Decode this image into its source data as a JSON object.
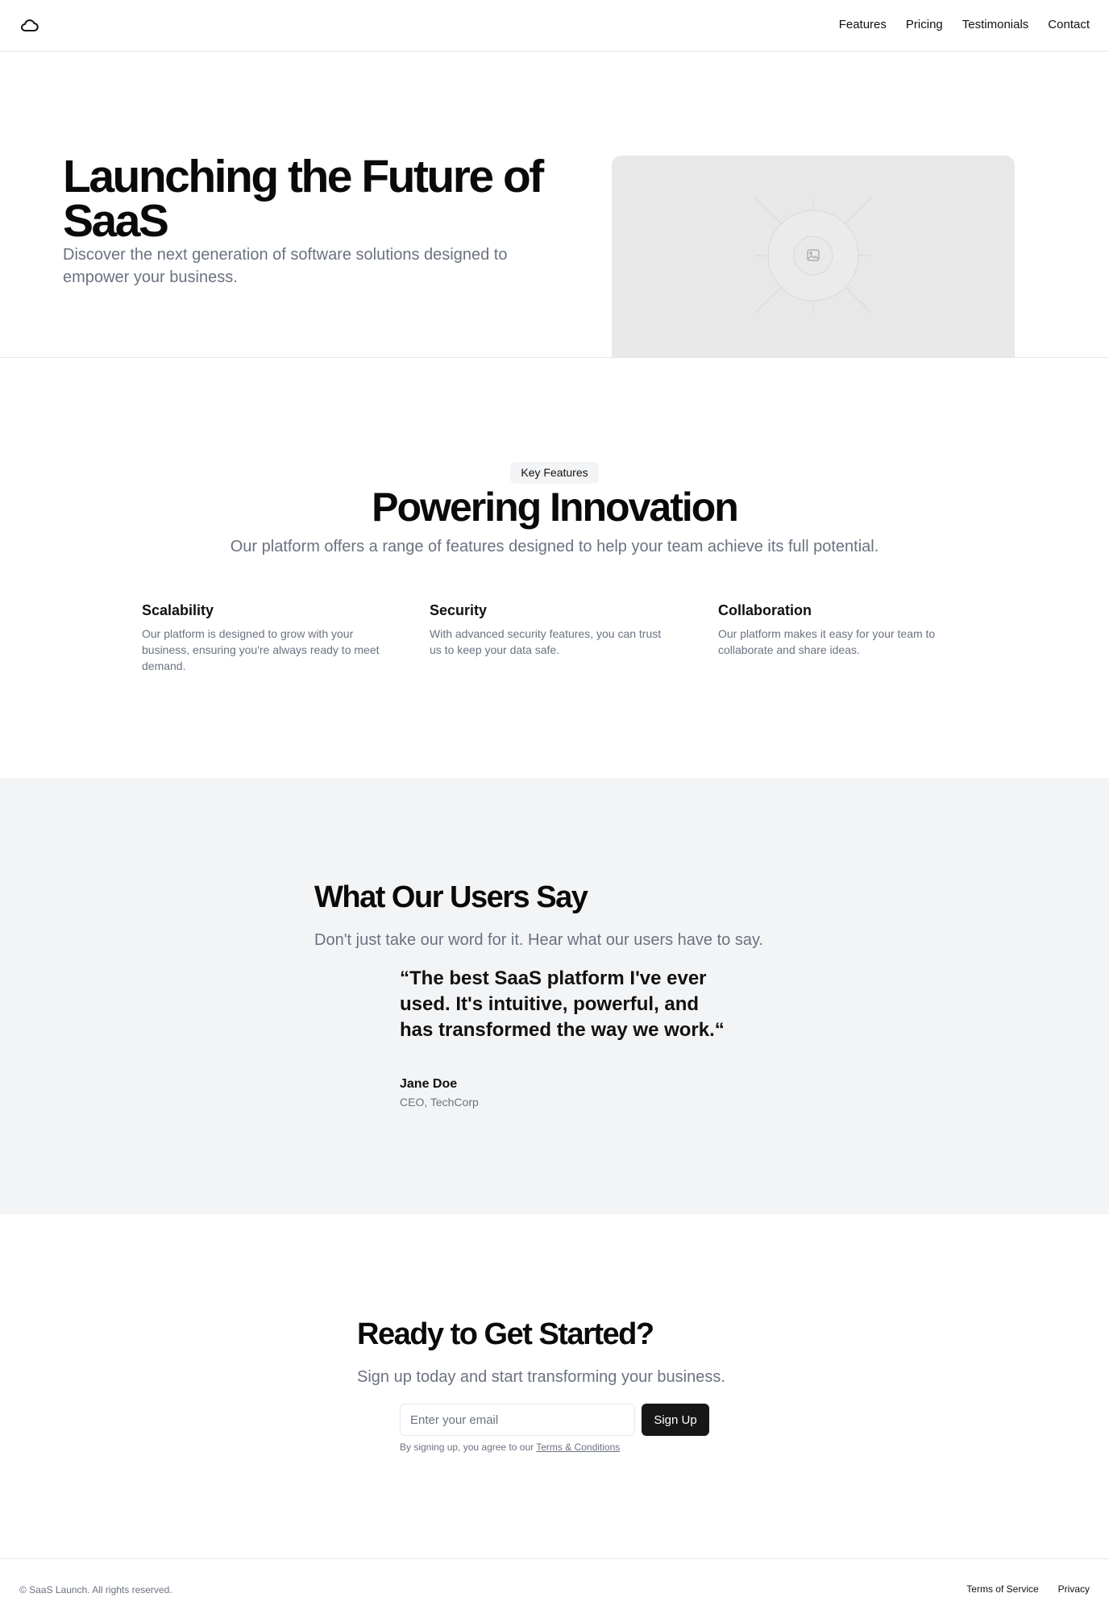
{
  "header": {
    "logo_icon": "cloud-icon",
    "nav": [
      "Features",
      "Pricing",
      "Testimonials",
      "Contact"
    ]
  },
  "hero": {
    "title": "Launching the Future of SaaS",
    "subtitle": "Discover the next generation of software solutions designed to empower your business.",
    "image_icon": "image-placeholder-icon"
  },
  "features": {
    "badge": "Key Features",
    "title": "Powering Innovation",
    "subtitle": "Our platform offers a range of features designed to help your team achieve its full potential.",
    "items": [
      {
        "title": "Scalability",
        "text": "Our platform is designed to grow with your business, ensuring you're always ready to meet demand."
      },
      {
        "title": "Security",
        "text": "With advanced security features, you can trust us to keep your data safe."
      },
      {
        "title": "Collaboration",
        "text": "Our platform makes it easy for your team to collaborate and share ideas."
      }
    ]
  },
  "testimonials": {
    "title": "What Our Users Say",
    "subtitle": "Don't just take our word for it. Hear what our users have to say.",
    "quote": "“The best SaaS platform I've ever used. It's intuitive, powerful, and has transformed the way we work.“",
    "author": "Jane Doe",
    "role": "CEO, TechCorp"
  },
  "cta": {
    "title": "Ready to Get Started?",
    "subtitle": "Sign up today and start transforming your business.",
    "email_placeholder": "Enter your email",
    "button": "Sign Up",
    "terms_prefix": "By signing up, you agree to our ",
    "terms_link": "Terms & Conditions"
  },
  "footer": {
    "copyright": "© SaaS Launch. All rights reserved.",
    "links": [
      "Terms of Service",
      "Privacy"
    ]
  },
  "colors": {
    "text": "#0a0a0a",
    "muted": "#6b7280",
    "section_bg": "#f3f4f6",
    "button_bg": "#171717",
    "placeholder_bg": "#e8e8e8"
  }
}
